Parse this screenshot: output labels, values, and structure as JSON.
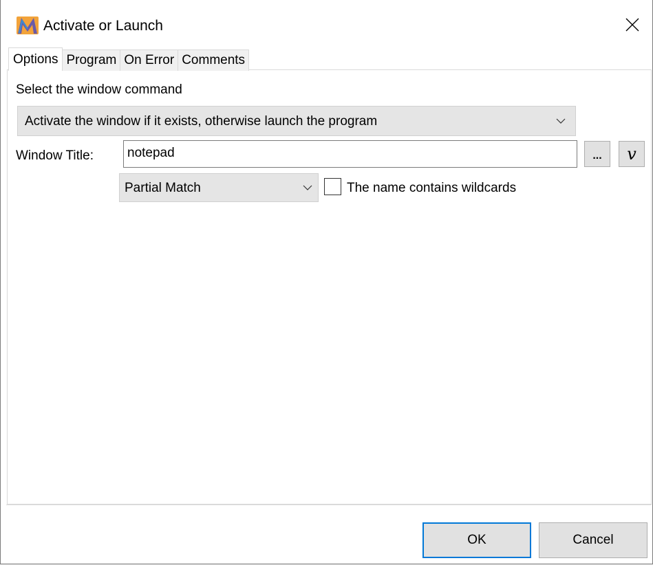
{
  "window": {
    "title": "Activate or Launch",
    "app_icon": "macro-m-logo-icon",
    "close_icon": "close-icon"
  },
  "tabs": [
    {
      "label": "Options",
      "active": true
    },
    {
      "label": "Program",
      "active": false
    },
    {
      "label": "On Error",
      "active": false
    },
    {
      "label": "Comments",
      "active": false
    }
  ],
  "options": {
    "select_label": "Select the window command",
    "command_value": "Activate the window if it exists, otherwise launch the program",
    "window_title_label": "Window Title:",
    "window_title_value": "notepad",
    "browse_button_label": "...",
    "variable_button_label": "v",
    "match_value": "Partial Match",
    "wildcards_checked": false,
    "wildcards_label": "The name contains wildcards"
  },
  "buttons": {
    "ok_label": "OK",
    "cancel_label": "Cancel"
  },
  "colors": {
    "focus_border": "#0078d7",
    "button_face": "#e1e1e1",
    "combo_face": "#e5e5e5"
  }
}
